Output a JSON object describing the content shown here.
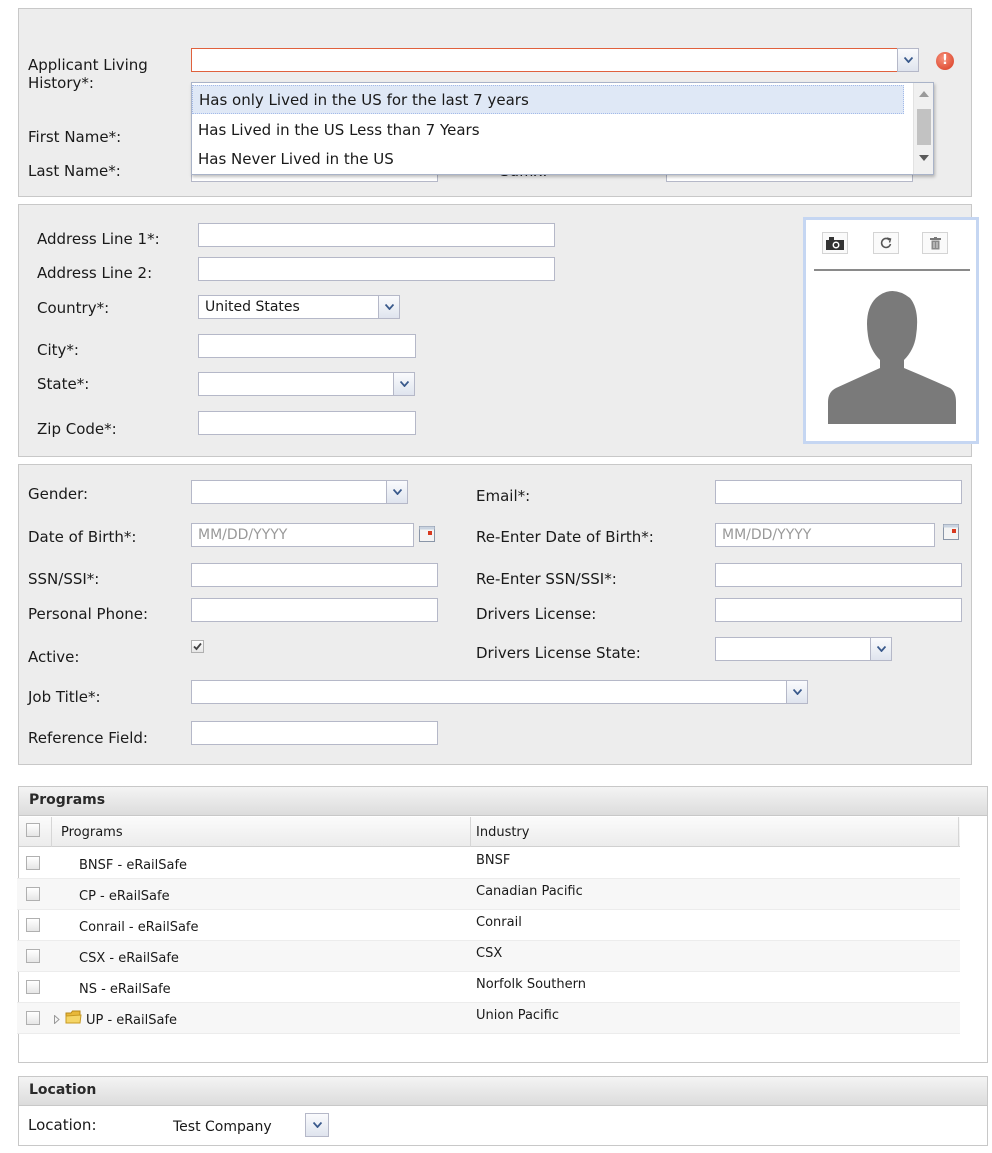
{
  "top": {
    "living_history_label": "Applicant Living History*:",
    "first_name_label": "First Name*:",
    "last_name_label": "Last Name*:",
    "suffix_label": "Suffix:",
    "dropdown_options": [
      "Has only Lived in the US for the last 7 years",
      "Has Lived in the US Less than 7 Years",
      "Has Never Lived in the US"
    ]
  },
  "address": {
    "line1_label": "Address Line 1*:",
    "line2_label": "Address Line 2:",
    "country_label": "Country*:",
    "country_value": "United States",
    "city_label": "City*:",
    "state_label": "State*:",
    "zip_label": "Zip Code*:"
  },
  "photo": {
    "icons": [
      "camera-icon",
      "refresh-icon",
      "trash-icon"
    ]
  },
  "personal": {
    "gender_label": "Gender:",
    "email_label": "Email*:",
    "dob_label": "Date of Birth*:",
    "dob_placeholder": "MM/DD/YYYY",
    "redob_label": "Re-Enter Date of Birth*:",
    "redob_placeholder": "MM/DD/YYYY",
    "ssn_label": "SSN/SSI*:",
    "ressn_label": "Re-Enter SSN/SSI*:",
    "phone_label": "Personal Phone:",
    "license_label": "Drivers License:",
    "active_label": "Active:",
    "active_checked": true,
    "license_state_label": "Drivers License State:",
    "job_title_label": "Job Title*:",
    "reference_label": "Reference Field:"
  },
  "programs": {
    "panel_title": "Programs",
    "col_programs": "Programs",
    "col_industry": "Industry",
    "rows": [
      {
        "program": "BNSF - eRailSafe",
        "industry": "BNSF"
      },
      {
        "program": "CP - eRailSafe",
        "industry": "Canadian Pacific"
      },
      {
        "program": "Conrail - eRailSafe",
        "industry": "Conrail"
      },
      {
        "program": "CSX - eRailSafe",
        "industry": "CSX"
      },
      {
        "program": "NS - eRailSafe",
        "industry": "Norfolk Southern"
      },
      {
        "program": "UP - eRailSafe",
        "industry": "Union Pacific"
      }
    ]
  },
  "location": {
    "panel_title": "Location",
    "label": "Location:",
    "value": "Test Company"
  },
  "colors": {
    "error_border": "#e0613d",
    "panel_bg": "#ededed",
    "photo_border": "#c5d6f2"
  }
}
